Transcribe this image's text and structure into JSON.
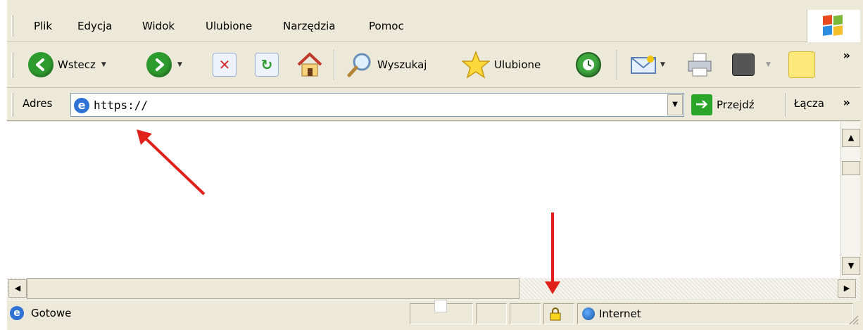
{
  "menu": {
    "items": [
      "Plik",
      "Edycja",
      "Widok",
      "Ulubione",
      "Narzędzia",
      "Pomoc"
    ]
  },
  "toolbar": {
    "back_label": "Wstecz",
    "search_label": "Wyszukaj",
    "favorites_label": "Ulubione",
    "chevron": "»"
  },
  "address": {
    "label": "Adres",
    "value": "https://",
    "go_label": "Przejdź",
    "links_label": "Łącza",
    "links_chevron": "»"
  },
  "status": {
    "text": "Gotowe",
    "zone": "Internet"
  },
  "colors": {
    "chrome": "#ece9d8",
    "annotation_arrow": "#e0201b",
    "back_green": "#2e9b2e",
    "stop_red": "#d32f2f"
  },
  "icons": {
    "windows_logo": "windows-flag-icon",
    "back": "back-arrow-icon",
    "forward": "forward-arrow-icon",
    "stop": "stop-icon",
    "refresh": "refresh-icon",
    "home": "home-icon",
    "search": "search-magnifier-icon",
    "favorites": "favorites-star-icon",
    "history": "history-icon",
    "mail": "mail-icon",
    "print": "print-icon",
    "edit": "edit-icon",
    "messenger": "messenger-icon",
    "address_page": "ie-page-icon",
    "go": "go-arrow-icon",
    "status_page": "ie-page-icon",
    "lock": "padlock-icon",
    "zone": "globe-icon"
  }
}
